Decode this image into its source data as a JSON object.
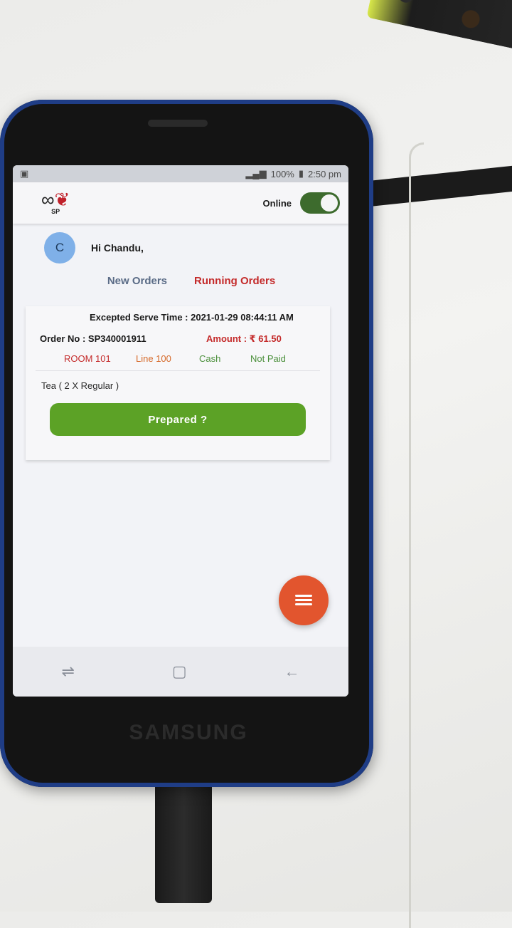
{
  "status_bar": {
    "battery": "100%",
    "time": "2:50 pm"
  },
  "app_bar": {
    "logo_text": "SP",
    "online_label": "Online",
    "online_state": "on"
  },
  "greeting": {
    "avatar_initial": "C",
    "text": "Hi Chandu,"
  },
  "tabs": [
    {
      "label": "New Orders",
      "active": false
    },
    {
      "label": "Running Orders",
      "active": true
    }
  ],
  "order": {
    "serve_time": "Excepted Serve Time : 2021-01-29 08:44:11 AM",
    "order_no": "Order No : SP340001911",
    "amount": "Amount : ₹ 61.50",
    "room": "ROOM 101",
    "line": "Line 100",
    "payment_mode": "Cash",
    "payment_status": "Not Paid",
    "item": "Tea  ( 2 X Regular )",
    "action_label": "Prepared ?"
  },
  "device": {
    "brand": "SAMSUNG"
  },
  "colors": {
    "accent_red": "#c42a2a",
    "button_green": "#5ca226",
    "fab_orange": "#e2552e",
    "toggle_green": "#3d6b2d"
  },
  "icons": {
    "fab": "menu-icon",
    "nav": [
      "recent-apps-icon",
      "home-icon",
      "back-icon"
    ]
  }
}
